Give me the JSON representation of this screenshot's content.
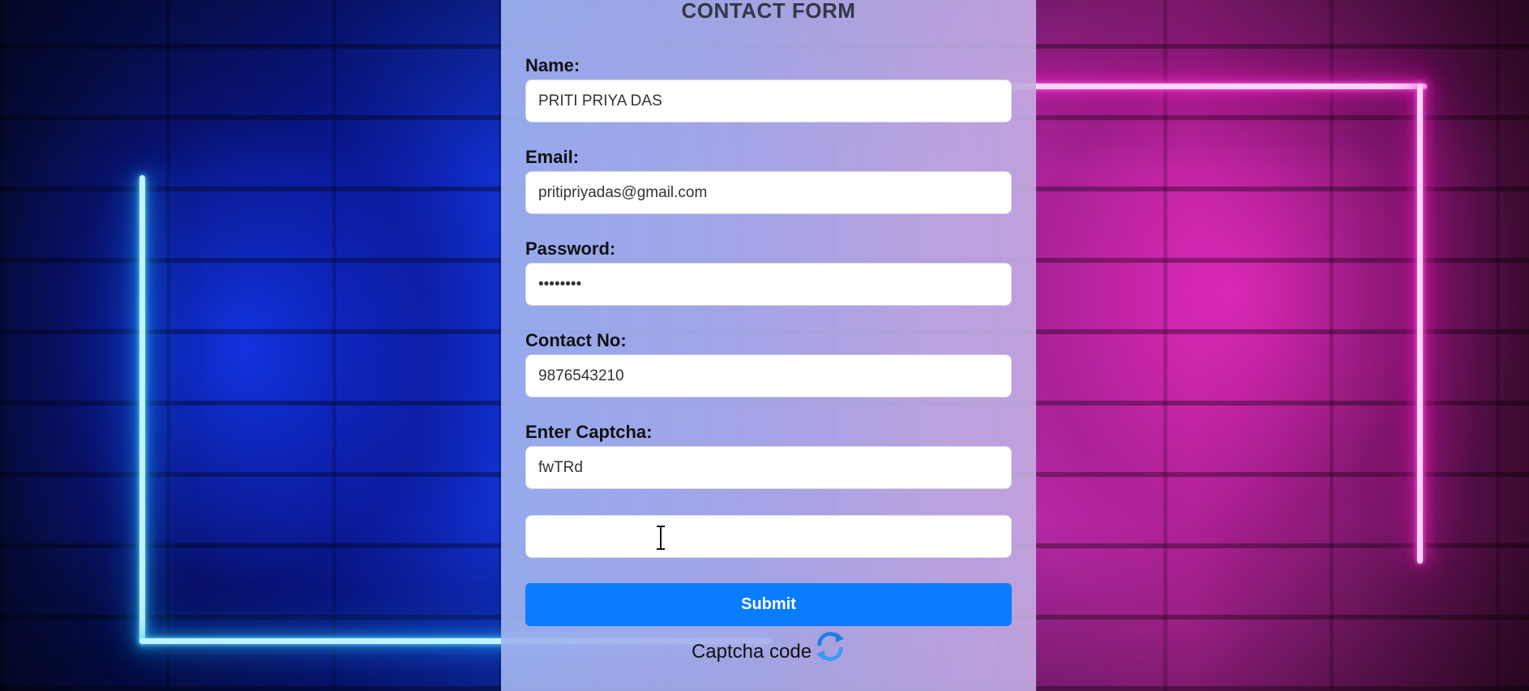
{
  "form": {
    "title": "CONTACT FORM",
    "name_label": "Name:",
    "name_value": "PRITI PRIYA DAS",
    "email_label": "Email:",
    "email_value": "pritipriyadas@gmail.com",
    "password_label": "Password:",
    "password_value": "••••••••",
    "contact_label": "Contact No:",
    "contact_value": "9876543210",
    "captcha_label": "Enter Captcha:",
    "captcha_value": "fwTRd",
    "captcha_entry_value": "",
    "submit_label": "Submit",
    "captcha_code_text": "Captcha code",
    "refresh_icon": "refresh-icon"
  },
  "colors": {
    "submit_bg": "#0a7cff",
    "neon_blue": "#2ac0ff",
    "neon_pink": "#ff30d0"
  }
}
